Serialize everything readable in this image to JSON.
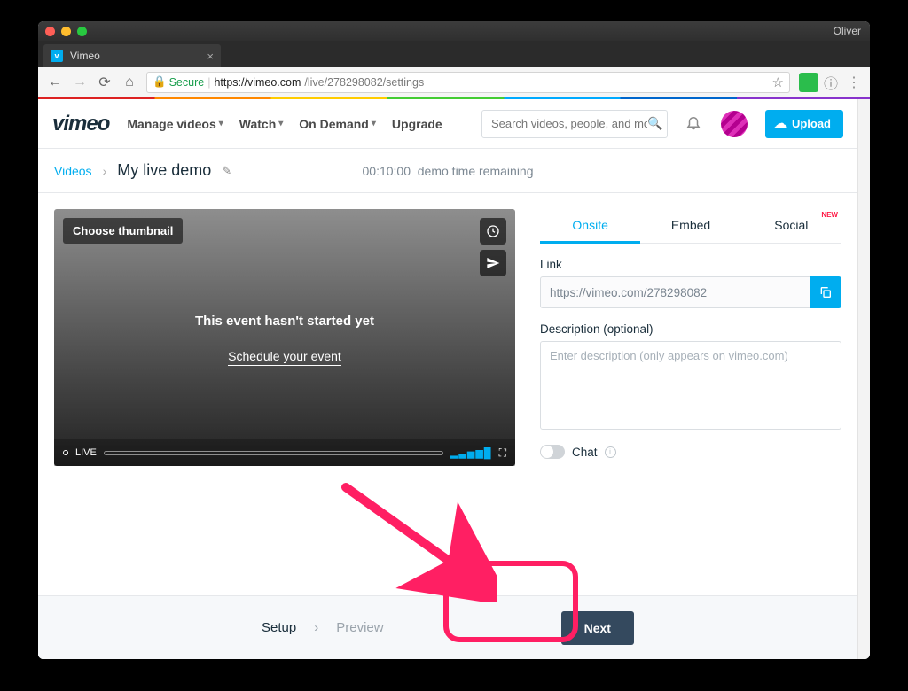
{
  "mac": {
    "user": "Oliver"
  },
  "browser": {
    "tab_title": "Vimeo",
    "secure_label": "Secure",
    "url_root": "https://vimeo.com",
    "url_path": "/live/278298082/settings"
  },
  "nav": {
    "logo": "vimeo",
    "items": [
      "Manage videos",
      "Watch",
      "On Demand",
      "Upgrade"
    ],
    "search_placeholder": "Search videos, people, and more",
    "upload_label": "Upload"
  },
  "crumb": {
    "root": "Videos",
    "title": "My live demo",
    "demo_time_value": "00:10:00",
    "demo_time_label": "demo time remaining"
  },
  "player": {
    "thumbnail_btn": "Choose thumbnail",
    "message": "This event hasn't started yet",
    "schedule_link": "Schedule your event",
    "live_label": "LIVE"
  },
  "right_panel": {
    "tabs": {
      "onsite": "Onsite",
      "embed": "Embed",
      "social": "Social",
      "new_badge": "NEW"
    },
    "link_label": "Link",
    "link_value": "https://vimeo.com/278298082",
    "desc_label": "Description (optional)",
    "desc_placeholder": "Enter description (only appears on vimeo.com)",
    "chat_label": "Chat"
  },
  "footer": {
    "setup": "Setup",
    "preview": "Preview",
    "next": "Next"
  }
}
